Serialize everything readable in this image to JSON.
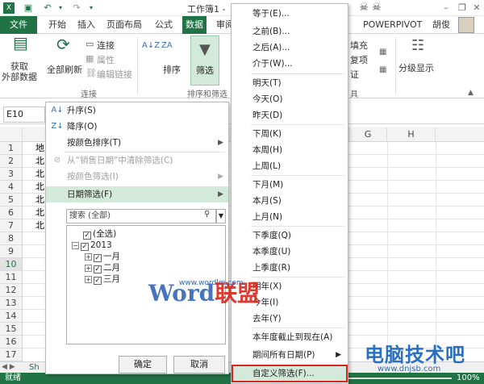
{
  "app": {
    "title": "工作簿1 -",
    "user": "胡俊"
  },
  "ribbon": {
    "tabs": [
      "文件",
      "开始",
      "插入",
      "页面布局",
      "公式",
      "数据",
      "审阅",
      "POWERPIVOT"
    ],
    "active_tab": "数据",
    "get_external_data": "获取\n外部数据",
    "refresh_all": "全部刷新",
    "connections": "连接",
    "properties": "属性",
    "edit_links": "编辑链接",
    "connections_group": "连接",
    "sort": "排序",
    "filter": "筛选",
    "sort_filter_group": "排序和筛选",
    "fill": "填充",
    "duplicates": "复项",
    "validation": "证",
    "tools_group": "具",
    "outline": "分级显示"
  },
  "formula_bar": {
    "name_box": "E10"
  },
  "grid": {
    "columns": [
      "G",
      "H"
    ],
    "rows": [
      "1",
      "2",
      "3",
      "4",
      "5",
      "6",
      "7",
      "8",
      "9",
      "10",
      "11",
      "12",
      "13",
      "14",
      "15",
      "16",
      "17"
    ],
    "selected_row": "10",
    "cells_a": [
      "地",
      "北",
      "北",
      "北",
      "北",
      "北",
      "北"
    ]
  },
  "filter_panel": {
    "sort_asc": "升序(S)",
    "sort_desc": "降序(O)",
    "sort_by_color": "按颜色排序(T)",
    "clear_filter": "从“销售日期”中清除筛选(C)",
    "filter_by_color": "按颜色筛选(I)",
    "date_filters": "日期筛选(F)",
    "search_placeholder": "搜索 (全部)",
    "tree": {
      "select_all": "(全选)",
      "year": "2013",
      "months": [
        "一月",
        "二月",
        "三月"
      ]
    },
    "ok": "确定",
    "cancel": "取消"
  },
  "date_menu": {
    "items": [
      "等于(E)...",
      "之前(B)...",
      "之后(A)...",
      "介于(W)...",
      "明天(T)",
      "今天(O)",
      "昨天(D)",
      "下周(K)",
      "本周(H)",
      "上周(L)",
      "下月(M)",
      "本月(S)",
      "上月(N)",
      "下季度(Q)",
      "本季度(U)",
      "上季度(R)",
      "明年(X)",
      "今年(I)",
      "去年(Y)",
      "本年度截止到现在(A)",
      "期间所有日期(P)",
      "自定义筛选(F)..."
    ]
  },
  "status": {
    "ready": "就绪",
    "zoom": "100%",
    "sheet": "Sh"
  },
  "watermarks": {
    "word_logo_main": "Word",
    "word_logo_red": "联盟",
    "word_url": "www.wordlm.com",
    "site_title": "电脑技术吧",
    "site_url": "www.dnjsb.com"
  }
}
